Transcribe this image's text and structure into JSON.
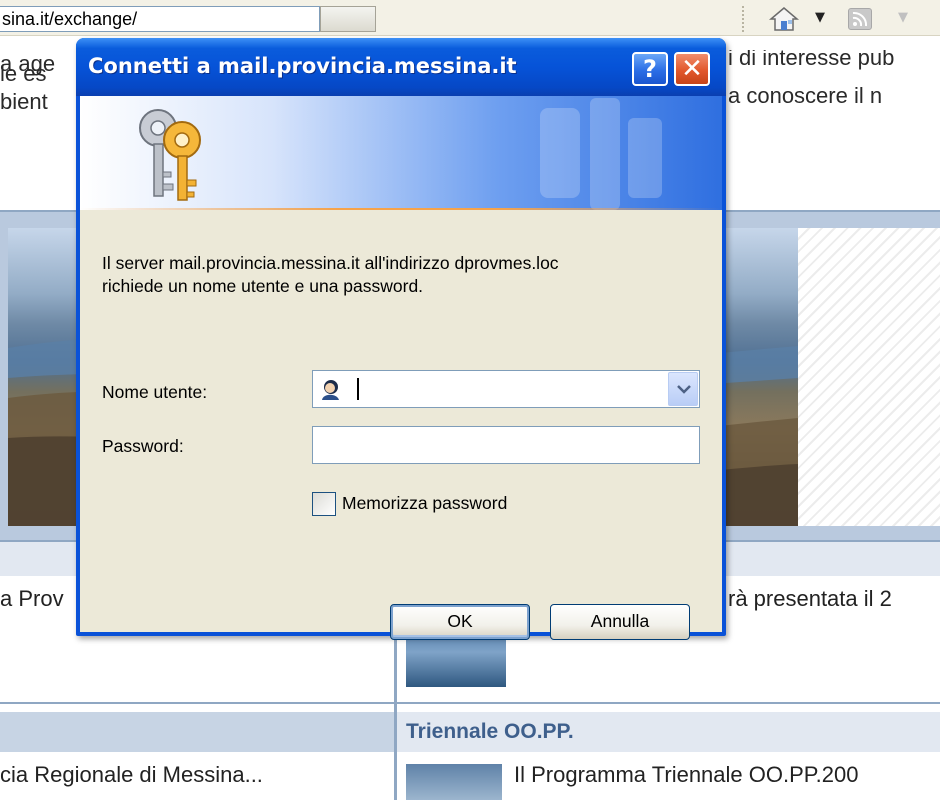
{
  "browser": {
    "address": "sina.it/exchange/",
    "toolbar_icons": [
      "home-icon",
      "chevron-down-icon",
      "feed-icon",
      "chevron-down-icon"
    ]
  },
  "page": {
    "intro_left": [
      "a age",
      "le es",
      "bient"
    ],
    "intro_right": [
      "i di interesse pub",
      "a conoscere il n"
    ],
    "news_row_1_left": "a Prov",
    "news_row_1_right": "rà presentata il 2",
    "triennale_heading": "Triennale OO.PP.",
    "news_row_2_left": "cia Regionale di Messina...",
    "news_row_2_right": "Il Programma Triennale OO.PP.200"
  },
  "dialog": {
    "title": "Connetti a mail.provincia.messina.it",
    "help_label": "?",
    "close_label": "✕",
    "message_line_1": "Il server mail.provincia.messina.it all'indirizzo dprovmes.loc",
    "message_line_2": "richiede un nome utente e una password.",
    "username_label": "Nome utente:",
    "username_value": "",
    "password_label": "Password:",
    "password_value": "",
    "remember_label": "Memorizza password",
    "remember_checked": false,
    "ok_label": "OK",
    "cancel_label": "Annulla"
  },
  "colors": {
    "titlebar_blue": "#0653d8",
    "dialog_face": "#ece9d8",
    "close_red": "#e2582c",
    "accent_orange": "#f6a34a",
    "link_heading_blue": "#3e5f8c"
  }
}
